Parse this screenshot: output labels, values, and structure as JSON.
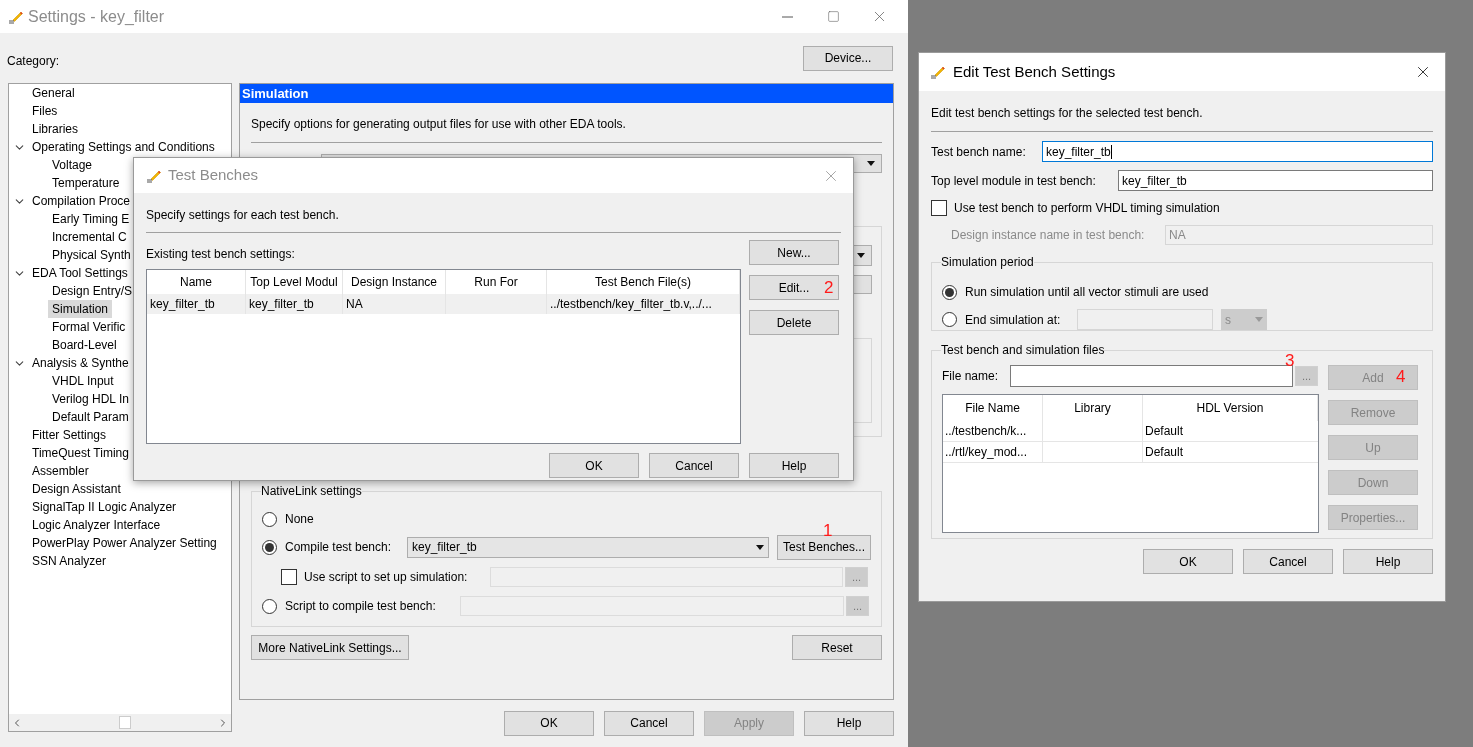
{
  "settings": {
    "title": "Settings - key_filter",
    "active": false,
    "category_label": "Category:",
    "device_button": "Device...",
    "tree": [
      {
        "label": "General",
        "selected": false
      },
      {
        "label": "Files",
        "selected": false
      },
      {
        "label": "Libraries",
        "selected": false
      },
      {
        "label": "Operating Settings and Conditions",
        "selected": false,
        "expanded": true,
        "children": [
          {
            "label": "Voltage",
            "selected": false
          },
          {
            "label": "Temperature",
            "selected": false
          }
        ]
      },
      {
        "label": "Compilation Proce",
        "selected": false,
        "expanded": true,
        "children": [
          {
            "label": "Early Timing E",
            "selected": false
          },
          {
            "label": "Incremental C",
            "selected": false
          },
          {
            "label": "Physical Synth",
            "selected": false
          }
        ]
      },
      {
        "label": "EDA Tool Settings",
        "selected": false,
        "expanded": true,
        "children": [
          {
            "label": "Design Entry/S",
            "selected": false
          },
          {
            "label": "Simulation",
            "selected": true
          },
          {
            "label": "Formal Verific",
            "selected": false
          },
          {
            "label": "Board-Level",
            "selected": false
          }
        ]
      },
      {
        "label": "Analysis & Synthe",
        "selected": false,
        "expanded": true,
        "children": [
          {
            "label": "VHDL Input",
            "selected": false
          },
          {
            "label": "Verilog HDL In",
            "selected": false
          },
          {
            "label": "Default Param",
            "selected": false
          }
        ]
      },
      {
        "label": "Fitter Settings",
        "selected": false
      },
      {
        "label": "TimeQuest Timing",
        "selected": false
      },
      {
        "label": "Assembler",
        "selected": false
      },
      {
        "label": "Design Assistant",
        "selected": false
      },
      {
        "label": "SignalTap II Logic Analyzer",
        "selected": false
      },
      {
        "label": "Logic Analyzer Interface",
        "selected": false
      },
      {
        "label": "PowerPlay Power Analyzer Setting",
        "selected": false
      },
      {
        "label": "SSN Analyzer",
        "selected": false
      }
    ],
    "panel": {
      "header": "Simulation",
      "description": "Specify options for generating output files for use with other EDA tools.",
      "nativelink": {
        "title": "NativeLink settings",
        "none": {
          "label": "None",
          "selected": false
        },
        "compile": {
          "label": "Compile test bench:",
          "selected": true,
          "value": "key_filter_tb",
          "button": "Test Benches...",
          "annotation": "1"
        },
        "use_script": {
          "label": "Use script to set up simulation:",
          "checked": false,
          "browse": "..."
        },
        "script_compile": {
          "label": "Script to compile test bench:",
          "selected": false,
          "browse": "..."
        }
      },
      "more_button": "More NativeLink Settings...",
      "reset_button": "Reset"
    },
    "buttons": [
      {
        "label": "OK",
        "disabled": false
      },
      {
        "label": "Cancel",
        "disabled": false
      },
      {
        "label": "Apply",
        "disabled": true
      },
      {
        "label": "Help",
        "disabled": false
      }
    ]
  },
  "test_benches": {
    "title": "Test Benches",
    "active": false,
    "description": "Specify settings for each test bench.",
    "table_label": "Existing test bench settings:",
    "columns": [
      "Name",
      "Top Level Modul",
      "Design Instance",
      "Run For",
      "Test Bench File(s)"
    ],
    "rows": [
      {
        "name": "key_filter_tb",
        "top_level_module": "key_filter_tb",
        "design_instance": "NA",
        "test_bench_files": "../testbench/key_filter_tb.v,../...",
        "selected": true
      }
    ],
    "side_buttons": [
      {
        "label": "New..."
      },
      {
        "label": "Edit...",
        "annotation": "2"
      },
      {
        "label": "Delete"
      }
    ],
    "buttons": [
      "OK",
      "Cancel",
      "Help"
    ]
  },
  "edit_dialog": {
    "title": "Edit Test Bench Settings",
    "active": true,
    "description": "Edit test bench settings for the selected test bench.",
    "name_field": {
      "label": "Test bench name:",
      "value": "key_filter_tb",
      "focused": true
    },
    "top_field": {
      "label": "Top level module in test bench:",
      "value": "key_filter_tb",
      "focused": false
    },
    "vhdl_timing": {
      "label": "Use test bench to perform VHDL timing simulation",
      "checked": false
    },
    "instance": {
      "label": "Design instance name in test bench:",
      "value": "NA",
      "disabled": true
    },
    "period": {
      "title": "Simulation period",
      "run_all": {
        "label": "Run simulation until all vector stimuli are used",
        "selected": true
      },
      "end_at": {
        "label": "End simulation at:",
        "selected": false,
        "unit": "s",
        "disabled": true
      }
    },
    "files": {
      "title": "Test bench and simulation files",
      "file_label": "File name:",
      "browse": "...",
      "browse_annotation": "3",
      "columns": [
        "File Name",
        "Library",
        "HDL Version"
      ],
      "rows": [
        {
          "file_name": "../testbench/k...",
          "hdl_version": "Default"
        },
        {
          "file_name": "../rtl/key_mod...",
          "hdl_version": "Default"
        }
      ],
      "side_buttons": [
        {
          "label": "Add",
          "disabled": true,
          "annotation": "4"
        },
        {
          "label": "Remove",
          "disabled": true
        },
        {
          "label": "Up",
          "disabled": true
        },
        {
          "label": "Down",
          "disabled": true
        },
        {
          "label": "Properties...",
          "disabled": true
        }
      ]
    },
    "buttons": [
      "OK",
      "Cancel",
      "Help"
    ]
  }
}
